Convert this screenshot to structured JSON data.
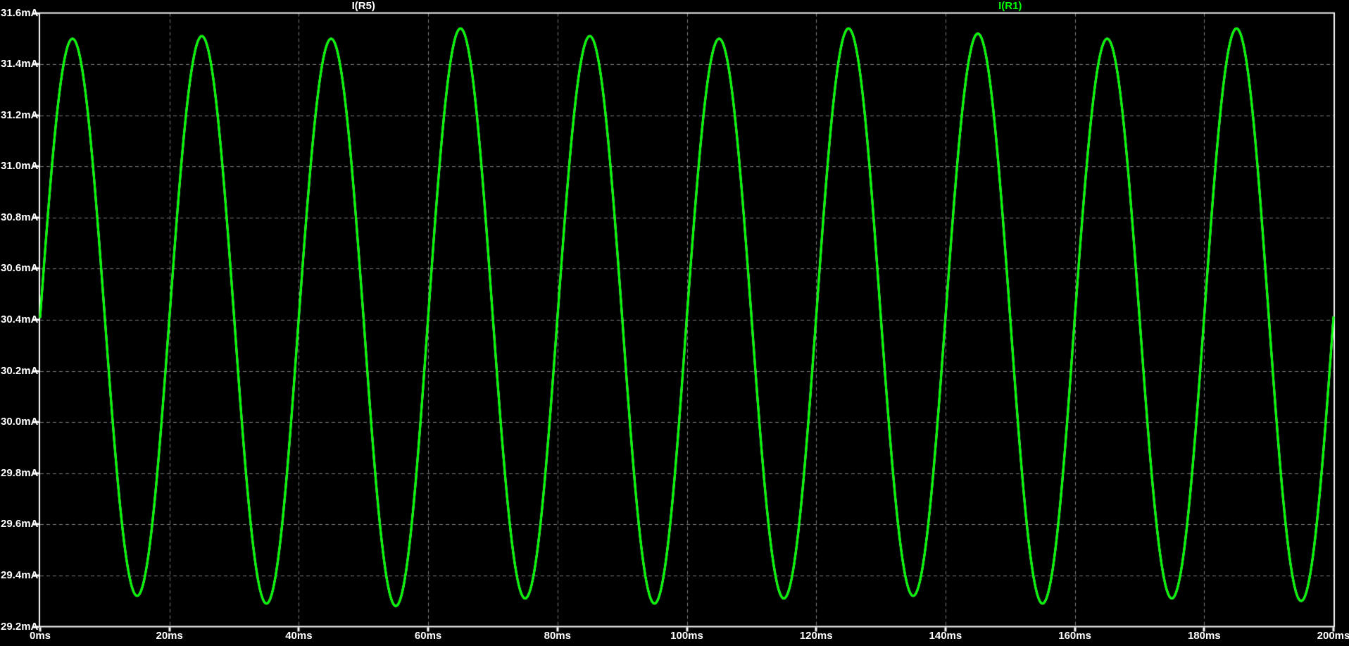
{
  "colors": {
    "background": "#000000",
    "frame": "#FFFFFF",
    "grid": "#828282",
    "tick_text": "#FFFFFF"
  },
  "legend": {
    "traces": [
      {
        "label": "I(R5)",
        "color": "#FFFFFF"
      },
      {
        "label": "I(R1)",
        "color": "#00FF00"
      }
    ]
  },
  "chart_data": {
    "type": "line",
    "x_unit": "ms",
    "y_unit": "mA",
    "xlim": [
      0,
      200
    ],
    "ylim": [
      29.2,
      31.6
    ],
    "grid": {
      "visible": true,
      "style": "dashed"
    },
    "legend_position": "top-center",
    "x_ticks": [
      {
        "value": 0,
        "label": "0ms"
      },
      {
        "value": 20,
        "label": "20ms"
      },
      {
        "value": 40,
        "label": "40ms"
      },
      {
        "value": 60,
        "label": "60ms"
      },
      {
        "value": 80,
        "label": "80ms"
      },
      {
        "value": 100,
        "label": "100ms"
      },
      {
        "value": 120,
        "label": "120ms"
      },
      {
        "value": 140,
        "label": "140ms"
      },
      {
        "value": 160,
        "label": "160ms"
      },
      {
        "value": 180,
        "label": "180ms"
      },
      {
        "value": 200,
        "label": "200ms"
      }
    ],
    "y_ticks": [
      {
        "value": 31.6,
        "label": "31.6mA"
      },
      {
        "value": 31.4,
        "label": "31.4mA"
      },
      {
        "value": 31.2,
        "label": "31.2mA"
      },
      {
        "value": 31.0,
        "label": "31.0mA"
      },
      {
        "value": 30.8,
        "label": "30.8mA"
      },
      {
        "value": 30.6,
        "label": "30.6mA"
      },
      {
        "value": 30.4,
        "label": "30.4mA"
      },
      {
        "value": 30.2,
        "label": "30.2mA"
      },
      {
        "value": 30.0,
        "label": "30.0mA"
      },
      {
        "value": 29.8,
        "label": "29.8mA"
      },
      {
        "value": 29.6,
        "label": "29.6mA"
      },
      {
        "value": 29.4,
        "label": "29.4mA"
      },
      {
        "value": 29.2,
        "label": "29.2mA"
      }
    ],
    "series": [
      {
        "name": "I(R5)",
        "color": "#FFFFFF",
        "waveform": "sine",
        "offset_mA": 30.41,
        "period_ms": 20,
        "phase_deg": 0,
        "cycle_peaks_mA": [
          31.5,
          31.51,
          31.5,
          31.54,
          31.51,
          31.5,
          31.54,
          31.52,
          31.5,
          31.54
        ],
        "cycle_troughs_mA": [
          29.32,
          29.29,
          29.28,
          29.31,
          29.29,
          29.31,
          29.32,
          29.29,
          29.31,
          29.3
        ]
      },
      {
        "name": "I(R1)",
        "color": "#00FF00",
        "waveform": "sine",
        "offset_mA": 30.41,
        "period_ms": 20,
        "phase_deg": 0,
        "cycle_peaks_mA": [
          31.5,
          31.51,
          31.5,
          31.54,
          31.51,
          31.5,
          31.54,
          31.52,
          31.5,
          31.54
        ],
        "cycle_troughs_mA": [
          29.32,
          29.29,
          29.28,
          29.31,
          29.29,
          29.31,
          29.32,
          29.29,
          29.31,
          29.3
        ]
      }
    ]
  }
}
